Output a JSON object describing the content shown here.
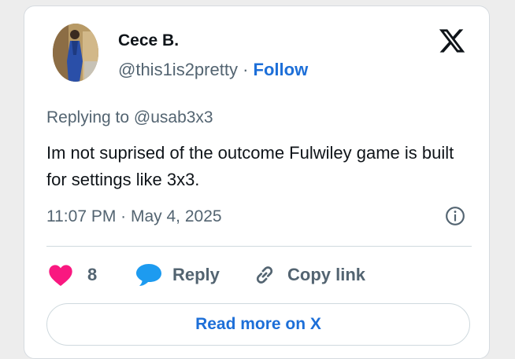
{
  "author": {
    "name": "Cece B.",
    "handle": "@this1is2pretty",
    "separator": "·",
    "follow_label": "Follow"
  },
  "tweet": {
    "replying_to": "Replying to @usab3x3",
    "text": "Im not suprised of the outcome Fulwiley game is built for settings like 3x3.",
    "timestamp": "11:07 PM · May 4, 2025"
  },
  "actions": {
    "like_count": "8",
    "reply_label": "Reply",
    "copy_label": "Copy link"
  },
  "read_more_label": "Read more on X",
  "colors": {
    "accent": "#1d6fd8",
    "like": "#f91880",
    "reply_bubble": "#1d9bf0",
    "muted_text": "#536471",
    "text": "#0f1419"
  },
  "icons": {
    "brand": "x-logo-icon",
    "info": "info-icon",
    "like": "heart-icon",
    "reply": "speech-bubble-icon",
    "copy": "link-icon"
  }
}
